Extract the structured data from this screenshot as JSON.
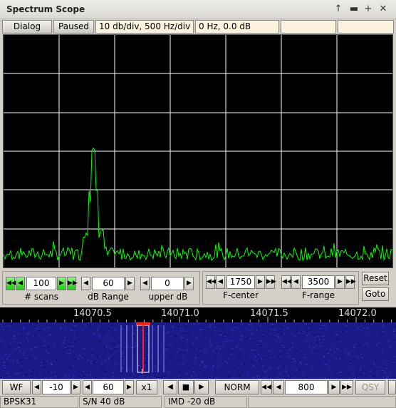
{
  "window": {
    "title": "Spectrum Scope",
    "controls": {
      "pin": "↑",
      "shade": "▬",
      "maximize": "+",
      "close": "✕"
    }
  },
  "toolbar": {
    "dialog_label": "Dialog",
    "paused_label": "Paused",
    "scale_info": "10 db/div, 500 Hz/div",
    "cursor_info": "0 Hz, 0.0 dB",
    "field3": "",
    "field4": ""
  },
  "spectrum": {
    "grid_color": "#ffffff",
    "trace_color": "#00ff00",
    "background": "#000000"
  },
  "controls": {
    "scans": {
      "value": "100",
      "label": "# scans"
    },
    "db_range": {
      "value": "60",
      "label": "dB Range"
    },
    "upper_db": {
      "value": "0",
      "label": "upper dB"
    },
    "f_center": {
      "value": "1750",
      "label": "F-center"
    },
    "f_range": {
      "value": "3500",
      "label": "F-range"
    },
    "reset_label": "Reset",
    "goto_label": "Goto"
  },
  "freq_scale": {
    "labels": [
      "14070.5",
      "14071.0",
      "14071.5",
      "14072.0"
    ]
  },
  "bottom": {
    "wf_label": "WF",
    "offset_value": "-10",
    "range_value": "60",
    "zoom_label": "x1",
    "norm_label": "NORM",
    "freq_value": "800",
    "qsy_label": "QSY"
  },
  "status": {
    "mode": "BPSK31",
    "sn": "S/N 40 dB",
    "imd": "IMD -20 dB"
  },
  "colors": {
    "waterfall_bg": "#1a1a8a",
    "cursor_red": "#ff2020",
    "field_bg": "#fdf3dd",
    "active_green": "#2bd41a"
  }
}
